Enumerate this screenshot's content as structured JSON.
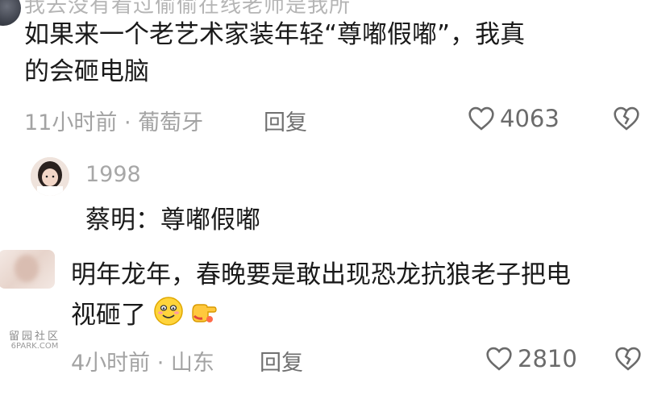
{
  "comment1": {
    "cut_text": "我去没有看过偷偷在线老师是我所",
    "line1": "如果来一个老艺术家装年轻“尊嘟假嘟”，我真",
    "line2": "的会砸电脑",
    "meta": "11小时前 · 葡萄牙",
    "reply": "回复",
    "likes": "4063"
  },
  "reply1": {
    "username": "1998",
    "text": "蔡明：尊嘟假嘟"
  },
  "comment2": {
    "line1": "明年龙年，春晚要是敢出现恐龙抗狼老子把电",
    "line2": "视砸了",
    "meta": "4小时前 · 山东",
    "reply": "回复",
    "likes": "2810"
  },
  "watermark": {
    "top": "留园社区",
    "bottom": "6PARK.COM"
  },
  "icons": {
    "like": "heart-outline-icon",
    "dislike": "broken-heart-icon",
    "emoji1": "smiling-face-emoji",
    "emoji2": "pointing-hand-emoji"
  }
}
